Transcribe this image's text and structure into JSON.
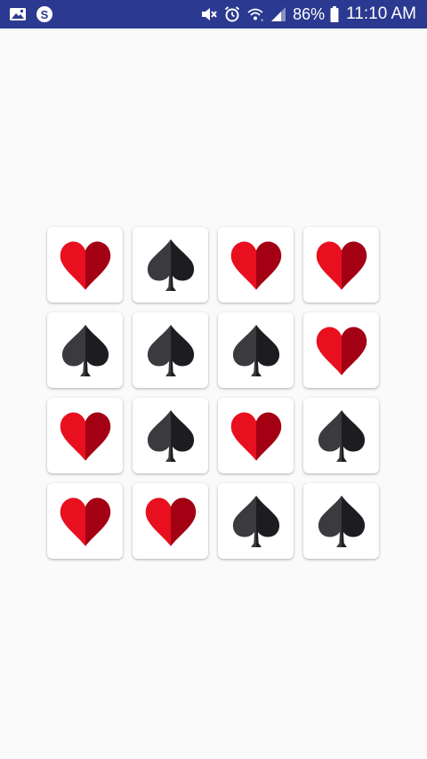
{
  "status_bar": {
    "left_icons": [
      "image-icon",
      "skype-icon"
    ],
    "right_icons": [
      "mute-icon",
      "alarm-icon",
      "wifi-icon",
      "signal-icon"
    ],
    "battery": "86%",
    "time": "11:10 AM",
    "background_color": "#2b3990"
  },
  "board": {
    "rows": 4,
    "cols": 4,
    "cards": [
      "heart",
      "spade",
      "heart",
      "heart",
      "spade",
      "spade",
      "spade",
      "heart",
      "heart",
      "spade",
      "heart",
      "spade",
      "heart",
      "heart",
      "spade",
      "spade"
    ],
    "colors": {
      "heart_light": "#e8101f",
      "heart_dark": "#a30014",
      "spade_light": "#3a3a3f",
      "spade_dark": "#1d1d21"
    }
  }
}
